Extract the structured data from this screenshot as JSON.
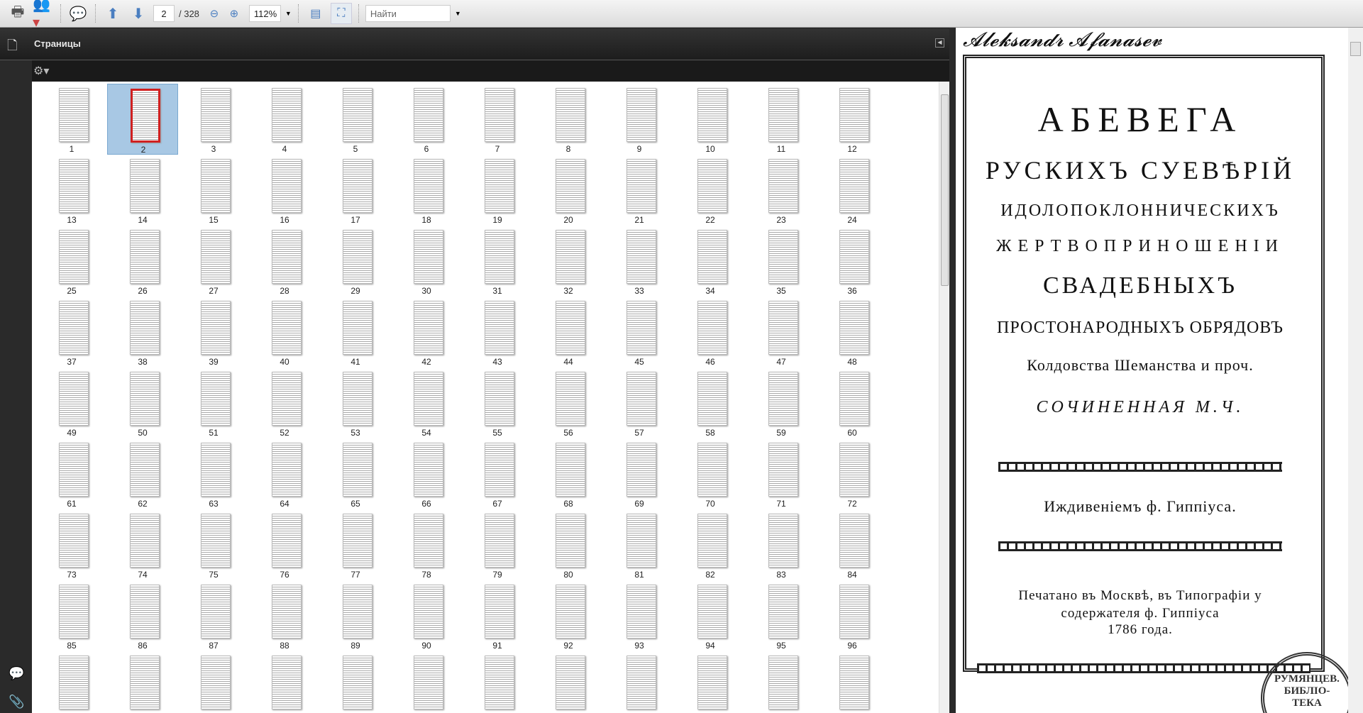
{
  "toolbar": {
    "page_current": "2",
    "page_total": "/ 328",
    "zoom": "112%",
    "find_placeholder": "Найти"
  },
  "panel": {
    "title": "Страницы"
  },
  "thumbnails": {
    "first": 1,
    "count": 108,
    "selected": 2,
    "columns": 12
  },
  "document": {
    "signature": "Александр Афанасьев",
    "lines": [
      "АБЕВЕГА",
      "РУСКИХЪ СУЕВѢРІЙ",
      "ИДОЛОПОКЛОННИЧЕСКИХЪ",
      "ЖЕРТВОПРИНОШЕНІИ",
      "СВАДЕБНЫХЪ",
      "ПРОСТОНАРОДНЫХЪ ОБРЯДОВЪ",
      "Колдовства Шеманства и проч.",
      "СОЧИНЕННАЯ М.Ч."
    ],
    "publisher": "Иждивенiемъ ф. Гиппiуса.",
    "imprint": [
      "Печатано въ Москвѣ, въ Типографiи у",
      "содержателя ф. Гиппiуса",
      "1786 года."
    ],
    "stamp": "РУМЯНЦЕВ. БИБЛIО-ТЕКА"
  }
}
